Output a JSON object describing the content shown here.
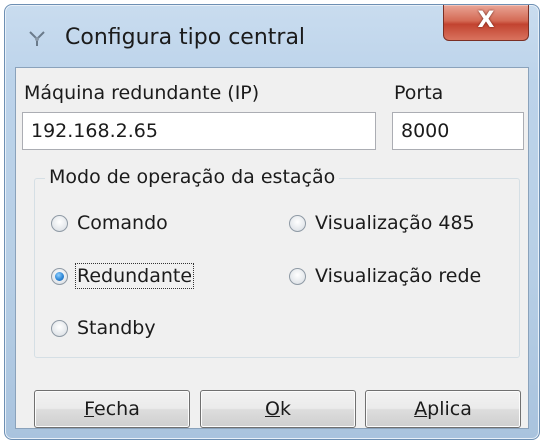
{
  "window": {
    "title": "Configura tipo central",
    "close_label": "X"
  },
  "fields": {
    "ip_label": "Máquina redundante (IP)",
    "ip_value": "192.168.2.65",
    "port_label": "Porta",
    "port_value": "8000"
  },
  "mode_group": {
    "title": "Modo de operação da estação",
    "options": [
      {
        "label": "Comando",
        "selected": false
      },
      {
        "label": "Visualização 485",
        "selected": false
      },
      {
        "label": "Redundante",
        "selected": true
      },
      {
        "label": "Visualização rede",
        "selected": false
      },
      {
        "label": "Standby",
        "selected": false
      }
    ]
  },
  "buttons": {
    "close": {
      "mnemonic": "F",
      "rest": "echa"
    },
    "ok": {
      "mnemonic": "O",
      "rest": "k"
    },
    "apply": {
      "mnemonic": "A",
      "rest": "plica"
    }
  }
}
